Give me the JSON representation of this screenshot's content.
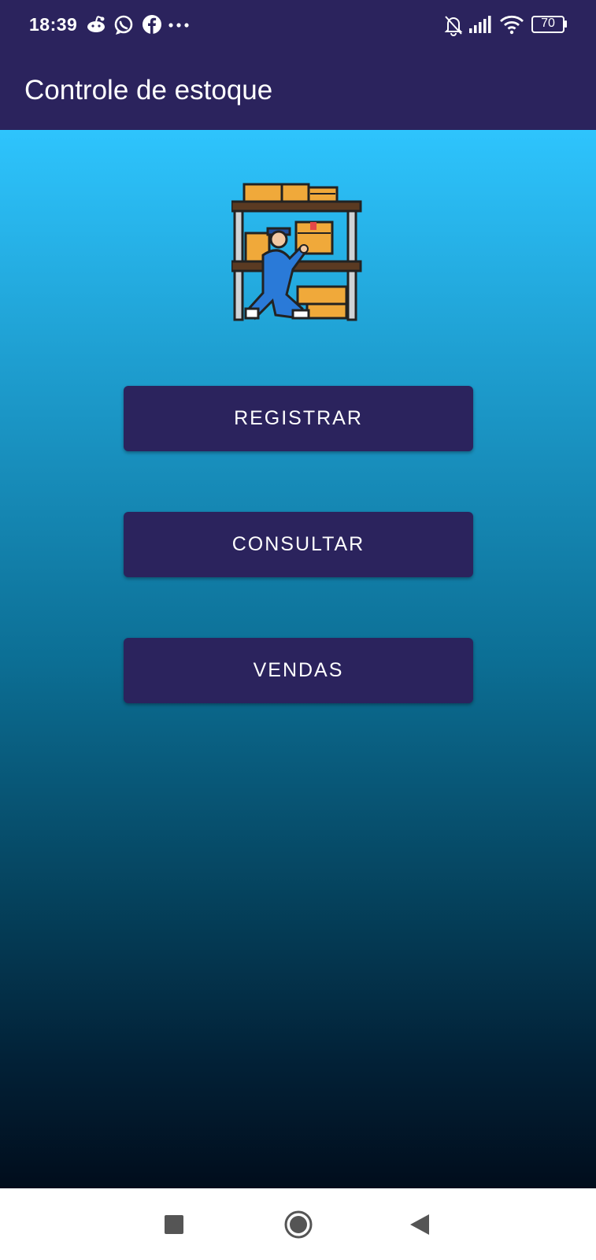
{
  "status_bar": {
    "time": "18:39",
    "left_icons": [
      "reddit-icon",
      "whatsapp-icon",
      "facebook-icon",
      "more-dots-icon"
    ],
    "right_icons": [
      "notifications-off-icon",
      "signal-icon",
      "wifi-icon",
      "battery-icon"
    ],
    "battery_level": "70"
  },
  "app_bar": {
    "title": "Controle de estoque"
  },
  "main": {
    "logo_icon": "warehouse-worker-icon",
    "buttons": [
      {
        "label": "REGISTRAR"
      },
      {
        "label": "CONSULTAR"
      },
      {
        "label": "VENDAS"
      }
    ]
  },
  "nav_bar": {
    "icons": [
      "recents-square-icon",
      "home-circle-icon",
      "back-triangle-icon"
    ]
  },
  "colors": {
    "primary": "#2b235d",
    "gradient_top": "#2ec4fd",
    "gradient_bottom": "#010d1c"
  }
}
